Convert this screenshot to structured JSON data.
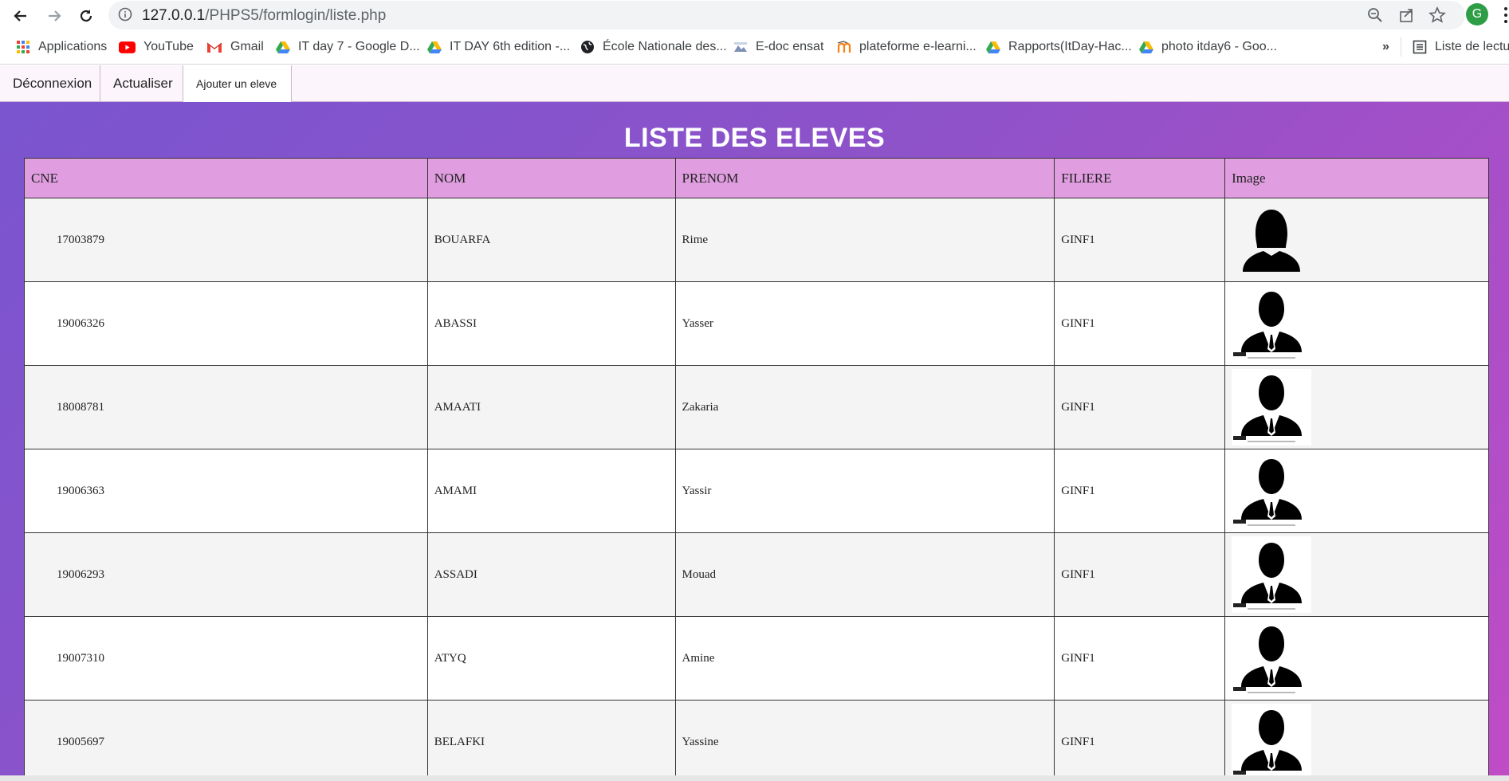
{
  "browser": {
    "url_host": "127.0.0.1",
    "url_path": "/PHPS5/formlogin/liste.php",
    "profile_initial": "G",
    "bookmarks": [
      {
        "label": "Applications",
        "icon": "apps-grid-icon"
      },
      {
        "label": "YouTube",
        "icon": "youtube-icon"
      },
      {
        "label": "Gmail",
        "icon": "gmail-icon"
      },
      {
        "label": "IT day 7 - Google D...",
        "icon": "google-drive-icon"
      },
      {
        "label": "IT DAY 6th edition -...",
        "icon": "google-drive-icon"
      },
      {
        "label": "École Nationale des...",
        "icon": "globe-icon"
      },
      {
        "label": "E-doc ensat",
        "icon": "edoc-icon"
      },
      {
        "label": "plateforme e-learni...",
        "icon": "moodle-icon"
      },
      {
        "label": "Rapports(ItDay-Hac...",
        "icon": "google-drive-icon"
      },
      {
        "label": "photo itday6 - Goo...",
        "icon": "google-drive-icon"
      }
    ],
    "overflow_label": "»",
    "reading_list_label": "Liste de lectu"
  },
  "menu": {
    "logout_label": "Déconnexion",
    "refresh_label": "Actualiser",
    "add_label": "Ajouter un eleve"
  },
  "page": {
    "title": "LISTE DES ELEVES",
    "accent_gradient": [
      "#7a55cf",
      "#c04cc6"
    ],
    "header_color": "#e09ee0"
  },
  "table": {
    "columns": [
      "CNE",
      "NOM",
      "PRENOM",
      "FILIERE",
      "Image"
    ],
    "rows": [
      {
        "cne": "17003879",
        "nom": "BOUARFA",
        "prenom": "Rime",
        "filiere": "GINF1",
        "image": "female-avatar"
      },
      {
        "cne": "19006326",
        "nom": "ABASSI",
        "prenom": "Yasser",
        "filiere": "GINF1",
        "image": "male-avatar"
      },
      {
        "cne": "18008781",
        "nom": "AMAATI",
        "prenom": "Zakaria",
        "filiere": "GINF1",
        "image": "male-avatar"
      },
      {
        "cne": "19006363",
        "nom": "AMAMI",
        "prenom": "Yassir",
        "filiere": "GINF1",
        "image": "male-avatar"
      },
      {
        "cne": "19006293",
        "nom": "ASSADI",
        "prenom": "Mouad",
        "filiere": "GINF1",
        "image": "male-avatar"
      },
      {
        "cne": "19007310",
        "nom": "ATYQ",
        "prenom": "Amine",
        "filiere": "GINF1",
        "image": "male-avatar"
      },
      {
        "cne": "19005697",
        "nom": "BELAFKI",
        "prenom": "Yassine",
        "filiere": "GINF1",
        "image": "male-avatar"
      }
    ]
  }
}
